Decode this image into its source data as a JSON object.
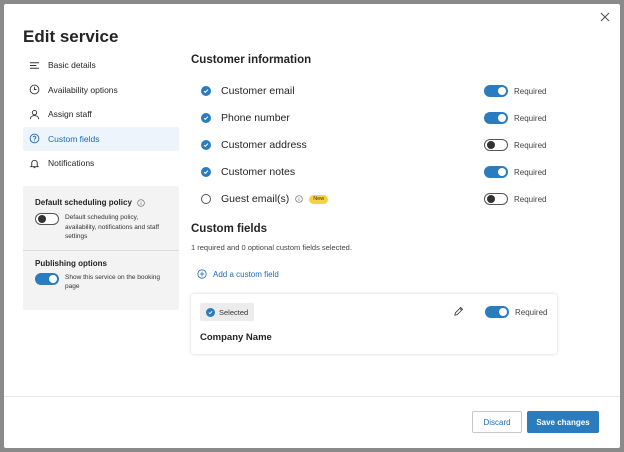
{
  "dialog": {
    "title": "Edit service"
  },
  "nav": {
    "items": [
      {
        "label": "Basic details",
        "icon": "list-icon"
      },
      {
        "label": "Availability options",
        "icon": "clock-icon"
      },
      {
        "label": "Assign staff",
        "icon": "person-icon"
      },
      {
        "label": "Custom fields",
        "icon": "question-circle-icon"
      },
      {
        "label": "Notifications",
        "icon": "bell-icon"
      }
    ],
    "active_index": 3
  },
  "policy": {
    "title": "Default scheduling policy",
    "description": "Default scheduling policy, availability, notifications and staff settings",
    "toggle_on": false
  },
  "publishing": {
    "title": "Publishing options",
    "description": "Show this service on the booking page",
    "toggle_on": true
  },
  "customer_info": {
    "title": "Customer information",
    "fields": [
      {
        "label": "Customer email",
        "checked": true,
        "required": true
      },
      {
        "label": "Phone number",
        "checked": true,
        "required": true
      },
      {
        "label": "Customer address",
        "checked": true,
        "required": false
      },
      {
        "label": "Customer notes",
        "checked": true,
        "required": true
      },
      {
        "label": "Guest email(s)",
        "checked": false,
        "required": false,
        "badge": "New"
      }
    ],
    "required_label": "Required"
  },
  "custom_fields": {
    "title": "Custom fields",
    "description": "1 required and 0 optional custom fields selected.",
    "add_label": "Add a custom field",
    "card": {
      "selected_label": "Selected",
      "name": "Company Name",
      "required_label": "Required",
      "required": true
    }
  },
  "footer": {
    "discard_label": "Discard",
    "save_label": "Save changes"
  },
  "colors": {
    "accent": "#2b7bbf",
    "link": "#1a6bb8",
    "badge": "#f7d23e"
  }
}
